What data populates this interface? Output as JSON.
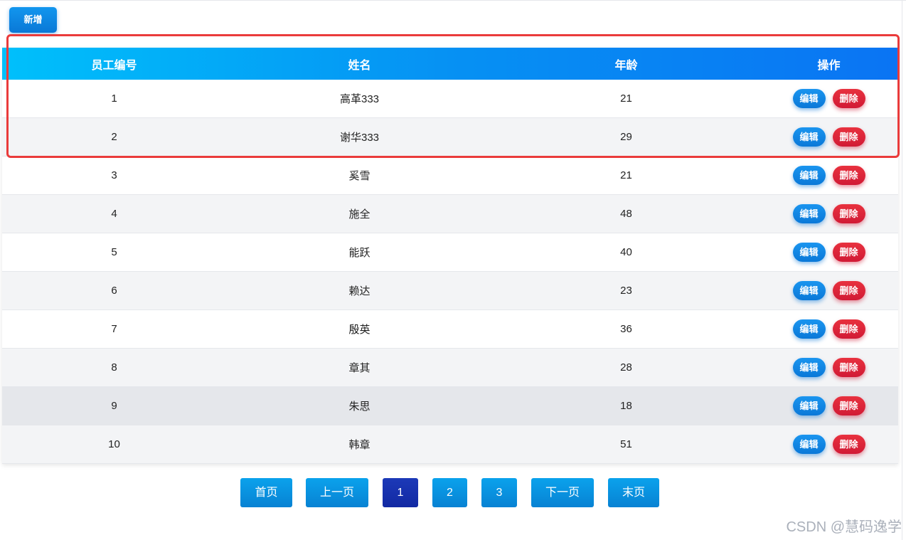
{
  "toolbar": {
    "add_label": "新增"
  },
  "table": {
    "headers": [
      "员工编号",
      "姓名",
      "年龄",
      "操作"
    ],
    "rows": [
      {
        "id": "1",
        "name": "高革333",
        "age": "21"
      },
      {
        "id": "2",
        "name": "谢华333",
        "age": "29"
      },
      {
        "id": "3",
        "name": "奚雪",
        "age": "21"
      },
      {
        "id": "4",
        "name": "施全",
        "age": "48"
      },
      {
        "id": "5",
        "name": "能跃",
        "age": "40"
      },
      {
        "id": "6",
        "name": "赖达",
        "age": "23"
      },
      {
        "id": "7",
        "name": "殷英",
        "age": "36"
      },
      {
        "id": "8",
        "name": "章其",
        "age": "28"
      },
      {
        "id": "9",
        "name": "朱思",
        "age": "18"
      },
      {
        "id": "10",
        "name": "韩章",
        "age": "51"
      }
    ],
    "edit_label": "编辑",
    "delete_label": "删除",
    "hovered_row": 9
  },
  "pagination": {
    "first": "首页",
    "prev": "上一页",
    "pages": [
      "1",
      "2",
      "3"
    ],
    "current": "1",
    "next": "下一页",
    "last": "末页"
  },
  "watermark": "CSDN @慧码逸学",
  "colors": {
    "header_start": "#00c0fb",
    "header_end": "#0a74f3",
    "primary": "#0a78d6",
    "danger": "#d11a35",
    "active_page": "#1c39b8",
    "highlight": "#ea3b3b"
  }
}
